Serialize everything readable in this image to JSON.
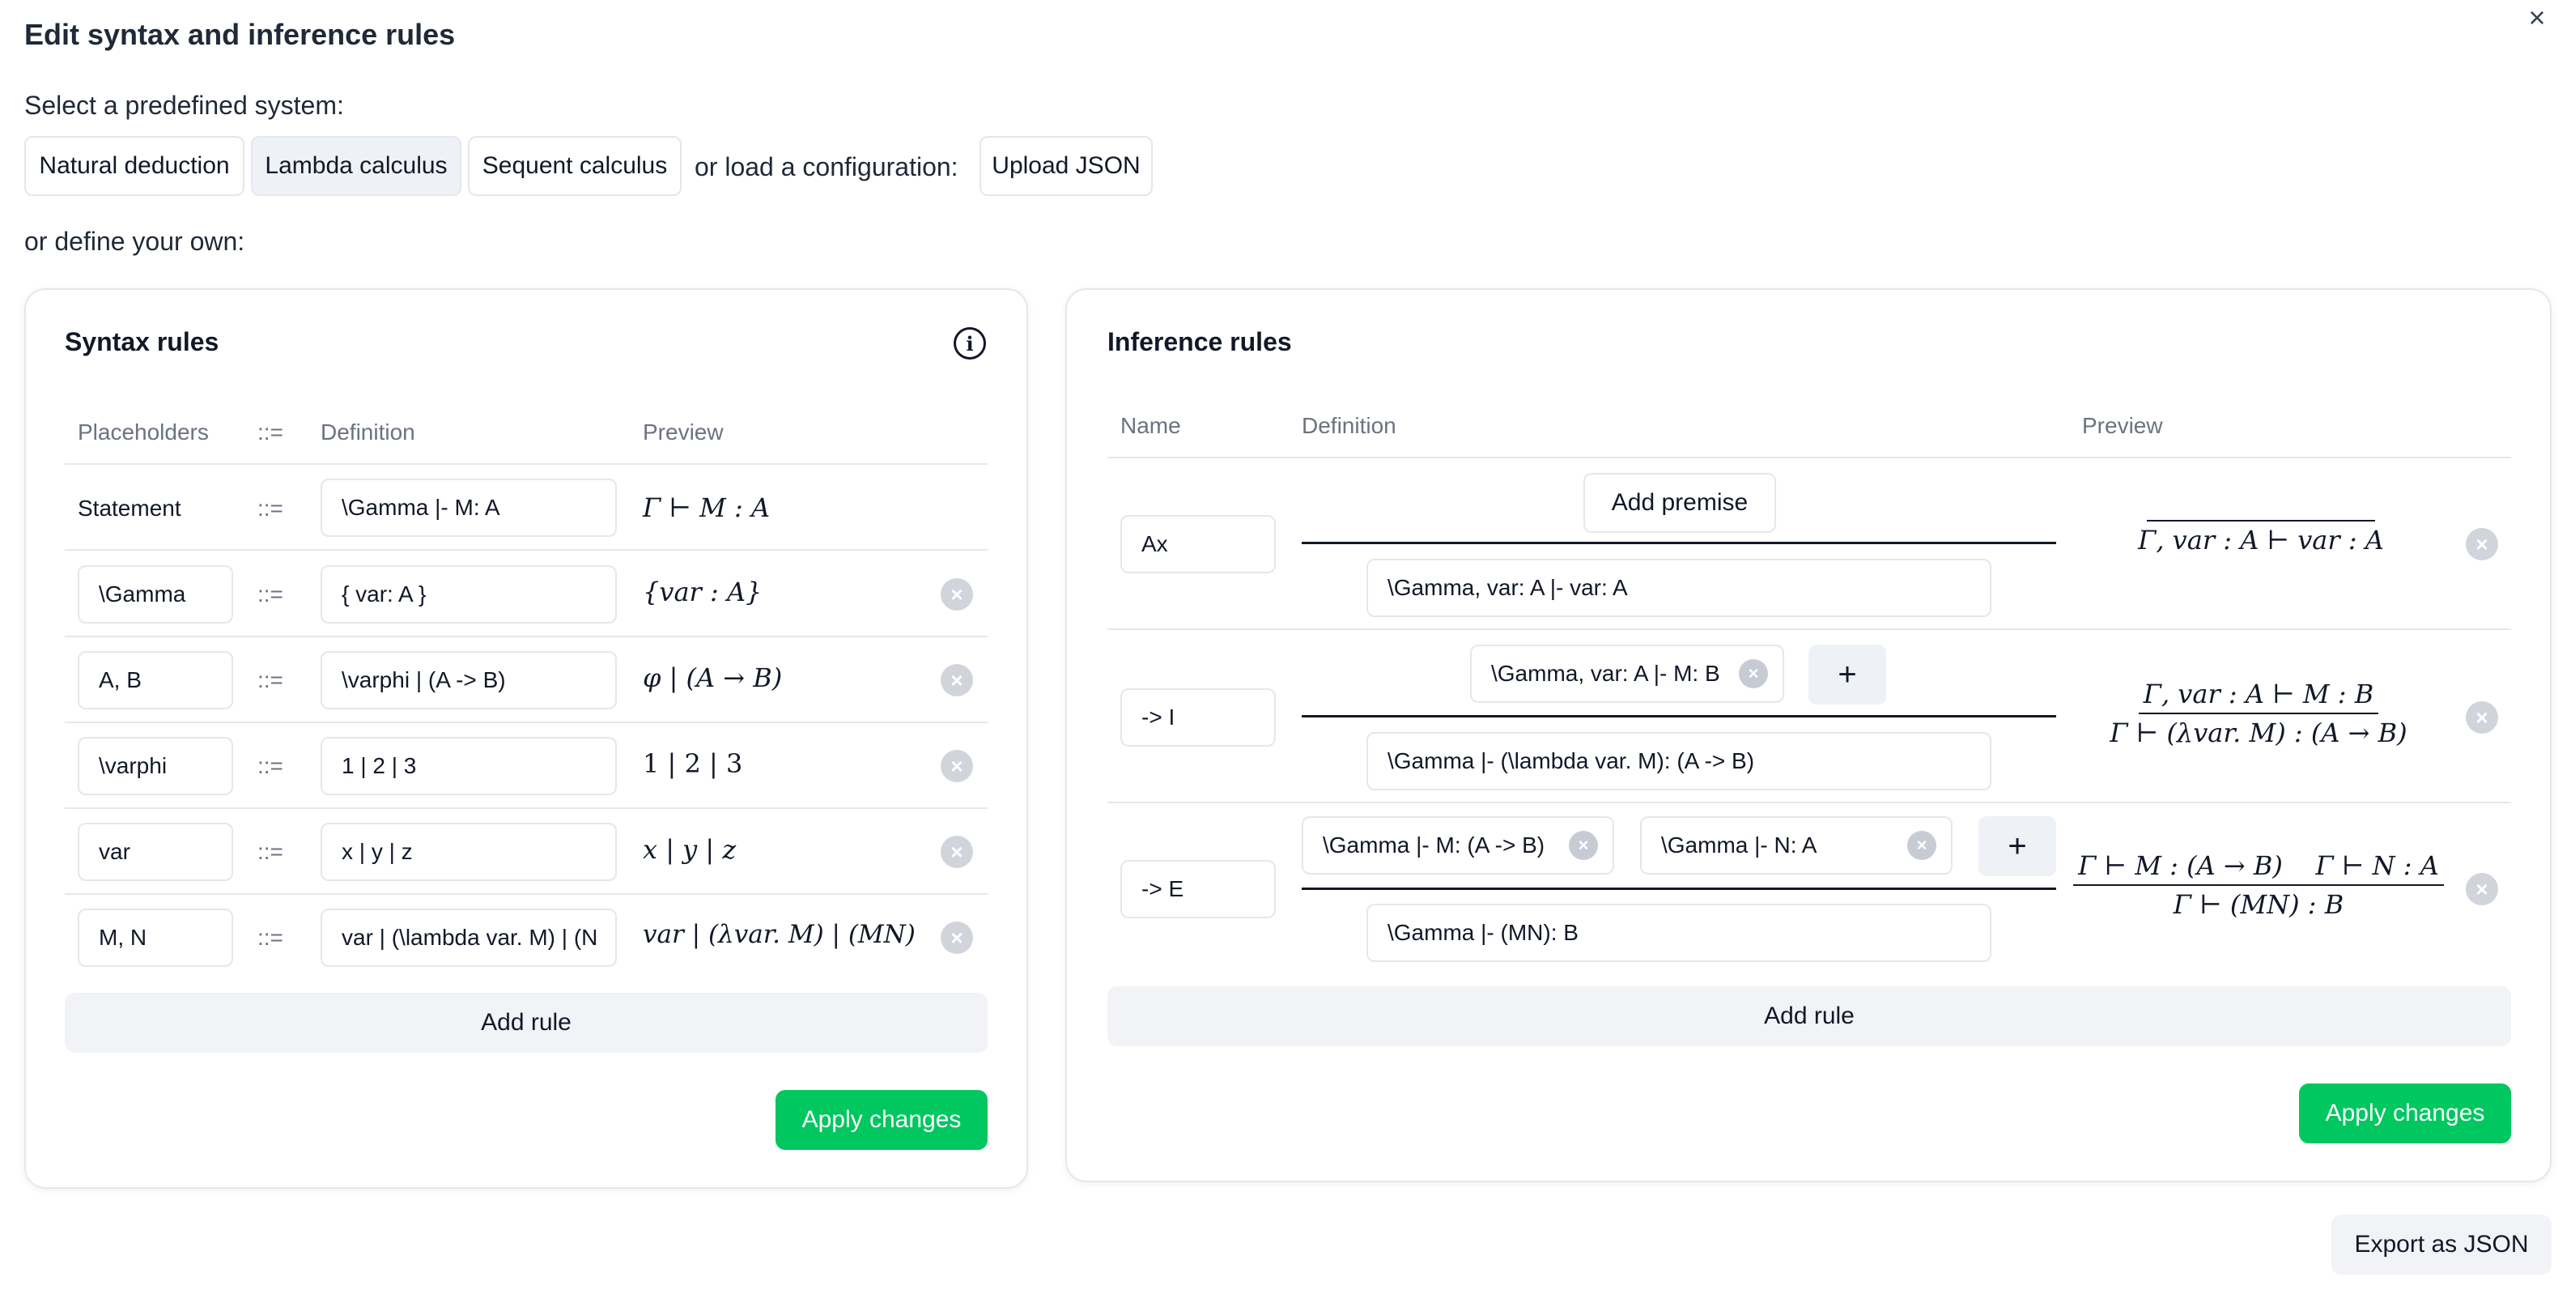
{
  "dialog": {
    "title": "Edit syntax and inference rules",
    "close": "×"
  },
  "predefined": {
    "label": "Select a predefined system:",
    "systems": [
      "Natural deduction",
      "Lambda calculus",
      "Sequent calculus"
    ],
    "load_label": "or load a configuration:",
    "upload_button": "Upload JSON",
    "define_label": "or define your own:"
  },
  "syntax": {
    "title": "Syntax rules",
    "info_icon": "info-icon",
    "headers": {
      "placeholders": "Placeholders",
      "sep": "::=",
      "definition": "Definition",
      "preview": "Preview"
    },
    "rows": [
      {
        "placeholder": "Statement",
        "sep": "::=",
        "definition": "\\Gamma |- M: A",
        "preview": "Γ ⊢ M : A"
      },
      {
        "placeholder": "\\Gamma",
        "sep": "::=",
        "definition": "{ var: A }",
        "preview": "{var : A}"
      },
      {
        "placeholder": "A, B",
        "sep": "::=",
        "definition": "\\varphi | (A -> B)",
        "preview": "φ | (A → B)"
      },
      {
        "placeholder": "\\varphi",
        "sep": "::=",
        "definition": "1 | 2 | 3",
        "preview": "1 | 2 | 3"
      },
      {
        "placeholder": "var",
        "sep": "::=",
        "definition": "x | y | z",
        "preview": "x | y | z"
      },
      {
        "placeholder": "M, N",
        "sep": "::=",
        "definition": "var | (\\lambda var. M) | (N",
        "preview": "var | (λvar. M) | (MN)"
      }
    ],
    "add_rule": "Add rule",
    "apply": "Apply changes"
  },
  "inference": {
    "title": "Inference rules",
    "headers": {
      "name": "Name",
      "definition": "Definition",
      "preview": "Preview"
    },
    "add_premise": "Add premise",
    "plus": "+",
    "rules": [
      {
        "name": "Ax",
        "premises": [],
        "conclusion": "\\Gamma, var: A |- var: A",
        "preview_num": "",
        "preview_den": "Γ, var : A ⊢ var : A"
      },
      {
        "name": "-> I",
        "premises": [
          "\\Gamma, var: A |- M: B"
        ],
        "conclusion": "\\Gamma |- (\\lambda var. M): (A -> B)",
        "preview_num": "Γ, var : A ⊢ M : B",
        "preview_den": "Γ ⊢ (λvar. M) : (A → B)"
      },
      {
        "name": "-> E",
        "premises": [
          "\\Gamma |- M: (A -> B)",
          "\\Gamma |- N: A"
        ],
        "conclusion": "\\Gamma |- (MN): B",
        "preview_num": "Γ ⊢ M : (A → B)    Γ ⊢ N : A",
        "preview_den": "Γ ⊢ (MN) : B"
      }
    ],
    "add_rule": "Add rule",
    "apply": "Apply changes"
  },
  "export": "Export as JSON",
  "colors": {
    "accent_green": "#00c760",
    "border": "#e5e7eb",
    "muted": "#6b7280"
  }
}
